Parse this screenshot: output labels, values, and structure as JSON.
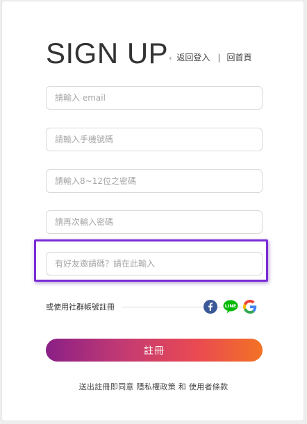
{
  "page": {
    "title": "SIGN UP",
    "nav": {
      "back_icon": "chevron-left-icon",
      "back_label": "返回登入",
      "separator": "|",
      "home_label": "回首頁"
    }
  },
  "form": {
    "email_placeholder": "請輸入 email",
    "phone_placeholder": "請輸入手機號碼",
    "password_placeholder": "請輸入8~12位之密碼",
    "confirm_password_placeholder": "請再次輸入密碼",
    "invite_code_placeholder": "有好友邀請碼？請在此輸入",
    "highlight_color": "#7a2bd6"
  },
  "social": {
    "label": "或使用社群帳號註冊",
    "providers": [
      "facebook-icon",
      "line-icon",
      "google-icon"
    ],
    "line_text": "LINE"
  },
  "submit": {
    "label": "註冊",
    "gradient": [
      "#8a1f86",
      "#ea4a52",
      "#f27224"
    ]
  },
  "terms": {
    "prefix": "送出註冊即同意 ",
    "privacy_label": "隱私權政策",
    "and": " 和 ",
    "tos_label": "使用者條款"
  }
}
